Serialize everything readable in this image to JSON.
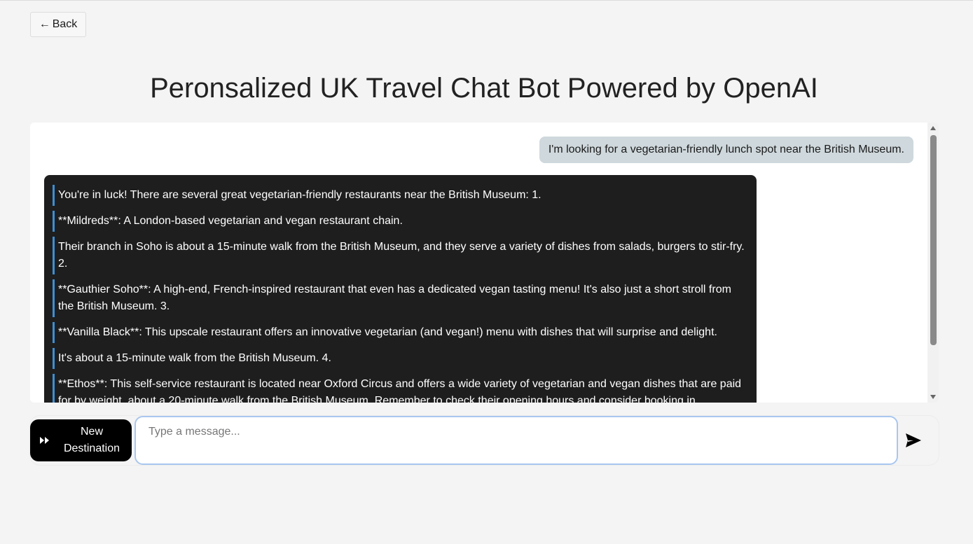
{
  "nav": {
    "back_label": "Back"
  },
  "header": {
    "title": "Peronsalized UK Travel Chat Bot Powered by OpenAI"
  },
  "chat": {
    "messages": [
      {
        "role": "user",
        "text": "I'm looking for a vegetarian-friendly lunch spot near the British Museum."
      },
      {
        "role": "assistant",
        "paragraphs": [
          "You're in luck! There are several great vegetarian-friendly restaurants near the British Museum: 1.",
          "**Mildreds**: A London-based vegetarian and vegan restaurant chain.",
          "Their branch in Soho is about a 15-minute walk from the British Museum, and they serve a variety of dishes from salads, burgers to stir-fry. 2.",
          "**Gauthier Soho**: A high-end, French-inspired restaurant that even has a dedicated vegan tasting menu! It's also just a short stroll from the British Museum. 3.",
          "**Vanilla Black**: This upscale restaurant offers an innovative vegetarian (and vegan!) menu with dishes that will surprise and delight.",
          "It's about a 15-minute walk from the British Museum. 4.",
          "**Ethos**: This self-service restaurant is located near Oxford Circus and offers a wide variety of vegetarian and vegan dishes that are paid for by weight, about a 20-minute walk from the British Museum. Remember to check their opening hours and consider booking in"
        ]
      }
    ]
  },
  "composer": {
    "new_destination_label": "New Destination",
    "new_destination_icon": "fast-forward-icon",
    "placeholder": "Type a message...",
    "send_icon": "send-icon"
  },
  "colors": {
    "user_bubble": "#cfd8dc",
    "assistant_bubble": "#1e1e1e",
    "paragraph_accent": "#3d8fd6",
    "input_focus_border": "#a9c6ef"
  }
}
